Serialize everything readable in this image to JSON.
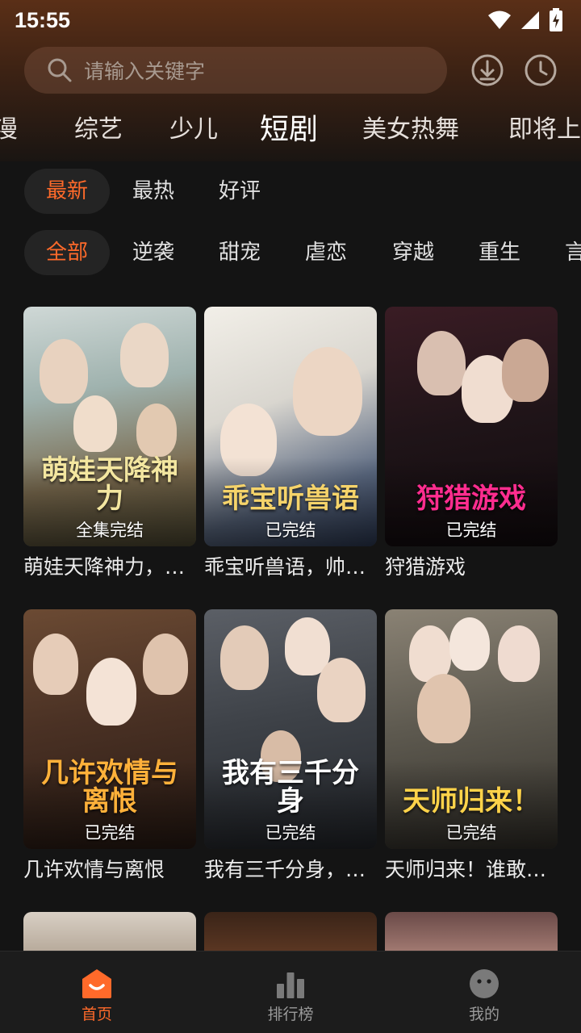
{
  "status": {
    "time": "15:55"
  },
  "search": {
    "placeholder": "请输入关键字"
  },
  "header_icons": [
    "download-icon",
    "history-icon"
  ],
  "categories": [
    "动漫",
    "综艺",
    "少儿",
    "短剧",
    "美女热舞",
    "即将上线"
  ],
  "active_category": "短剧",
  "sort_tabs": [
    "最新",
    "最热",
    "好评"
  ],
  "active_sort": "最新",
  "genre_tabs": [
    "全部",
    "逆袭",
    "甜宠",
    "虐恋",
    "穿越",
    "重生",
    "言情"
  ],
  "active_genre": "全部",
  "cards": [
    {
      "title": "萌娃天降神力，又把京城掀翻啦",
      "poster_text": "萌娃天降神力",
      "status": "全集完结",
      "accent": "#f3e6a0"
    },
    {
      "title": "乖宝听兽语，帅总掌心宠",
      "poster_text": "乖宝听兽语",
      "status": "已完结",
      "accent": "#f5d36a"
    },
    {
      "title": "狩猎游戏",
      "poster_text": "狩猎游戏",
      "status": "已完结",
      "accent": "#ff2d8f"
    },
    {
      "title": "几许欢情与离恨",
      "poster_text": "几许欢情与离恨",
      "status": "已完结",
      "accent": "#ffb13a"
    },
    {
      "title": "我有三千分身，进厂打螺丝",
      "poster_text": "我有三千分身",
      "status": "已完结",
      "accent": "#ffffff"
    },
    {
      "title": "天师归来！谁敢欺负我姐",
      "poster_text": "天师归来！",
      "status": "已完结",
      "accent": "#ffd34a"
    }
  ],
  "nav": [
    {
      "label": "首页",
      "icon": "home-icon",
      "active": true
    },
    {
      "label": "排行榜",
      "icon": "ranking-icon",
      "active": false
    },
    {
      "label": "我的",
      "icon": "profile-icon",
      "active": false
    }
  ],
  "colors": {
    "accent": "#ff6a2a",
    "background": "#141414"
  }
}
